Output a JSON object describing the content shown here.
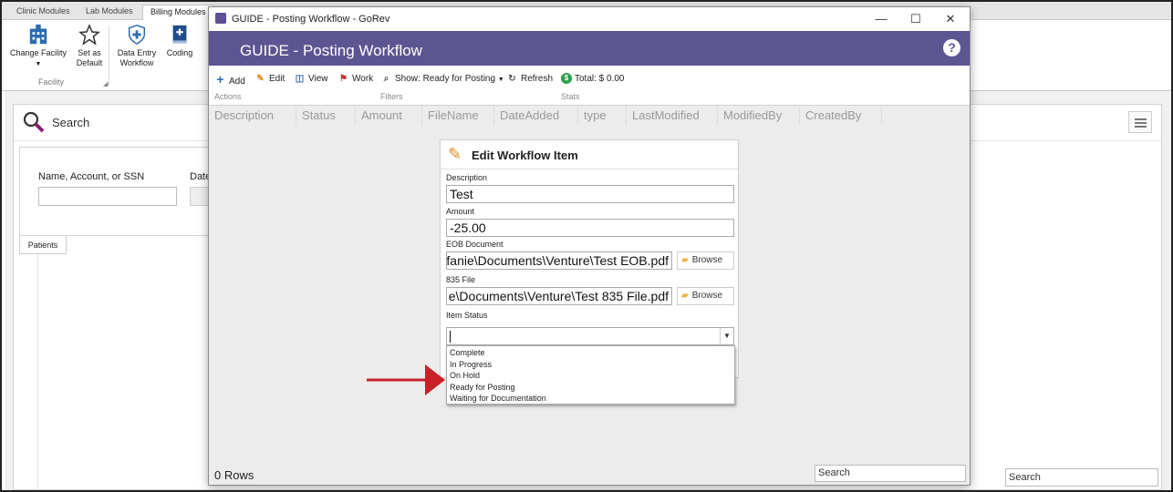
{
  "background_app": {
    "tabs": [
      "Clinic Modules",
      "Lab Modules",
      "Billing Modules"
    ],
    "ribbon": {
      "change_facility": "Change Facility",
      "set_default": "Set as Default",
      "data_entry": "Data Entry Workflow",
      "coding": "Coding",
      "group_label": "Facility"
    },
    "search_title": "Search",
    "criteria_label": "Name, Account, or SSN",
    "date_label": "Date o",
    "patients_tab": "Patients",
    "search_box": "Search"
  },
  "window": {
    "title": "GUIDE - Posting Workflow - GoRev",
    "header": "GUIDE - Posting Workflow",
    "help": "?",
    "toolbar": {
      "add": "Add",
      "edit": "Edit",
      "view": "View",
      "work": "Work",
      "show": "Show: Ready for Posting",
      "refresh": "Refresh",
      "total": "Total: $ 0.00",
      "groups": [
        "Actions",
        "Filters",
        "Stats"
      ]
    },
    "columns": [
      "Description",
      "Status",
      "Amount",
      "FileName",
      "DateAdded",
      "type",
      "LastModified",
      "ModifiedBy",
      "CreatedBy"
    ],
    "rows_count": "0 Rows",
    "search_placeholder": "Search"
  },
  "edit_panel": {
    "title": "Edit Workflow Item",
    "description_label": "Description",
    "description_value": "Test",
    "amount_label": "Amount",
    "amount_value": "-25.00",
    "eob_label": "EOB Document",
    "eob_value": "fanie\\Documents\\Venture\\Test EOB.pdf",
    "file835_label": "835 File",
    "file835_value": "e\\Documents\\Venture\\Test 835 File.pdf",
    "browse": "Browse",
    "status_label": "Item Status",
    "status_options": [
      "Complete",
      "In Progress",
      "On Hold",
      "Ready for Posting",
      "Waiting for Documentation"
    ]
  },
  "colors": {
    "header": "#5d5592",
    "arrow": "#c9202a",
    "money": "#2e9e4e"
  }
}
